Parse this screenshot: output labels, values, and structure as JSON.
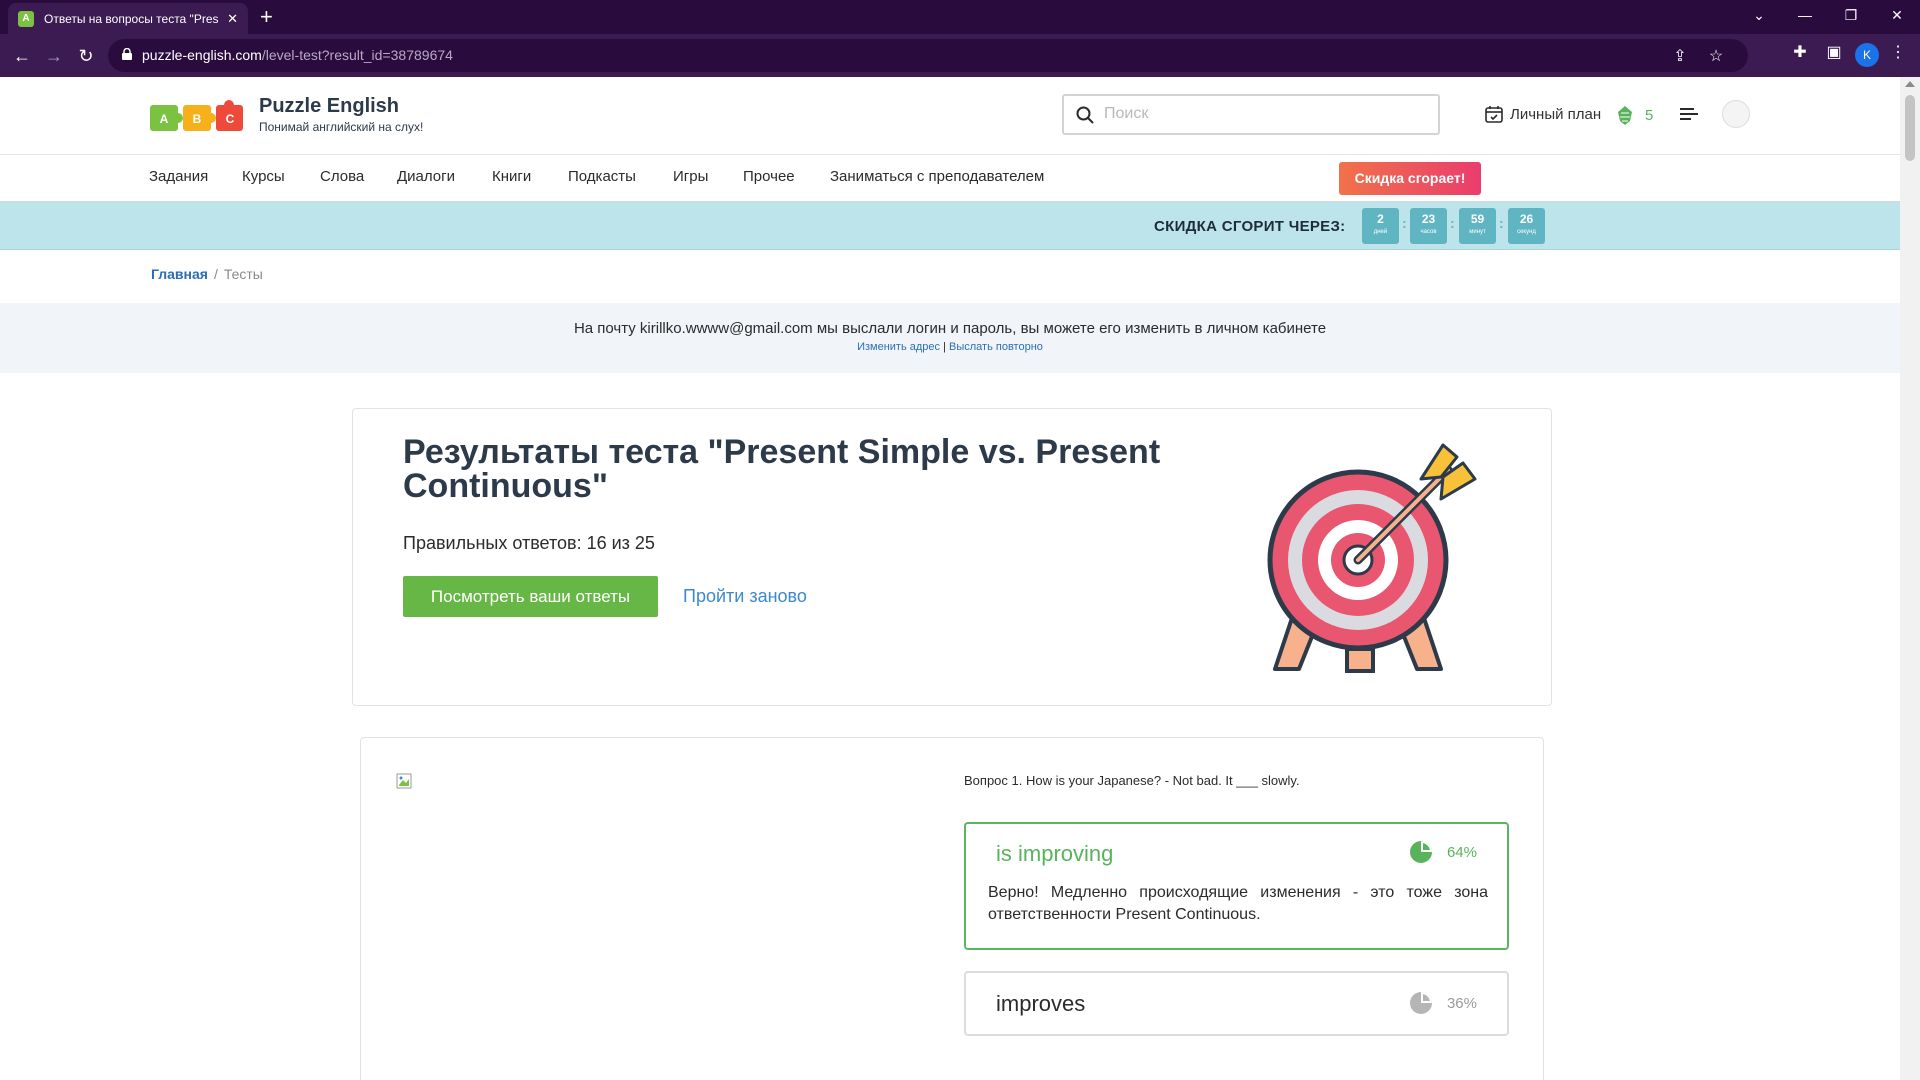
{
  "browser": {
    "tab_title": "Ответы на вопросы теста \"Present Simple vs. Present Continuous\"",
    "tab_icon": "abc-puzzle-icon",
    "url_host": "puzzle-english.com",
    "url_path": "/level-test?result_id=38789674",
    "profile_initial": "K",
    "window_buttons": [
      "chevron-down-icon",
      "minimize-icon",
      "restore-icon",
      "close-icon"
    ]
  },
  "header": {
    "brand": "Puzzle English",
    "slogan": "Понимай английский на слух!",
    "search_placeholder": "Поиск",
    "plan_label": "Личный план",
    "points": "5"
  },
  "nav": {
    "items": [
      "Задания",
      "Курсы",
      "Слова",
      "Диалоги",
      "Книги",
      "Подкасты",
      "Игры",
      "Прочее",
      "Заниматься с преподавателем"
    ],
    "discount_button": "Скидка сгорает!"
  },
  "countdown": {
    "label": "СКИДКА СГОРИТ ЧЕРЕЗ:",
    "units": [
      {
        "value": "2",
        "unit": "дней"
      },
      {
        "value": "23",
        "unit": "часов"
      },
      {
        "value": "59",
        "unit": "минут"
      },
      {
        "value": "26",
        "unit": "секунд"
      }
    ]
  },
  "breadcrumb": {
    "home": "Главная",
    "separator": "/",
    "current": "Тесты"
  },
  "notice": {
    "text": "На почту kirillko.wwww@gmail.com мы выслали логин и пароль, вы можете его изменить в личном кабинете",
    "change_link": "Изменить адрес",
    "separator": "|",
    "resend_link": "Выслать повторно"
  },
  "result": {
    "title": "Результаты теста \"Present Simple vs. Present Continuous\"",
    "score": "Правильных ответов: 16 из 25",
    "view_button": "Посмотреть ваши ответы",
    "retake_link": "Пройти заново"
  },
  "question": {
    "text": "Вопрос 1. How is your Japanese? - Not bad. It ___ slowly.",
    "answers": [
      {
        "text": "is improving",
        "percent": "64%",
        "share": 0.64,
        "correct": true,
        "explanation": "Верно! Медленно происходящие изменения - это тоже зона ответственности Present Continuous."
      },
      {
        "text": "improves",
        "percent": "36%",
        "share": 0.36,
        "correct": false
      }
    ]
  },
  "colors": {
    "accent_green": "#67b747",
    "link_blue": "#3b88d1",
    "countdown_bg": "#bde4ea",
    "discount_gradient": [
      "#f0724a",
      "#ea3d6d"
    ]
  }
}
